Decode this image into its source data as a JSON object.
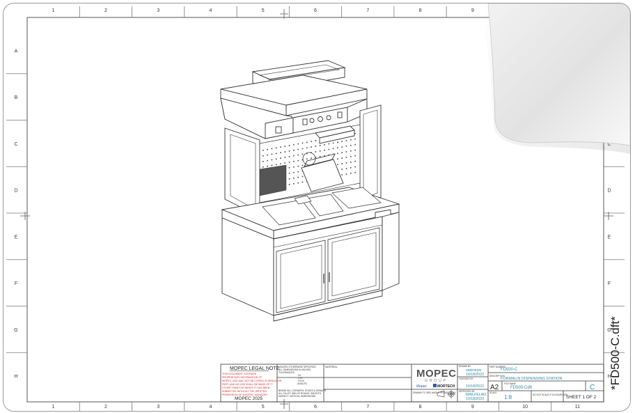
{
  "document": {
    "filename_tab": "*FD500-C.dft*",
    "columns": [
      "1",
      "2",
      "3",
      "4",
      "5",
      "6",
      "7",
      "8",
      "9",
      "10",
      "11"
    ],
    "rows": [
      "A",
      "B",
      "C",
      "D",
      "E",
      "F",
      "G",
      "H"
    ]
  },
  "revision_table": {
    "headers": [
      "REV",
      "DESCRIPTION",
      "DATE",
      "CHK'D",
      "MARK"
    ],
    "row": [
      "A",
      "INITIAL RELEASE",
      "00-000-00",
      "XXXXX",
      "MM"
    ]
  },
  "legal_note": {
    "title": "MOPEC LEGAL NOTE",
    "lines": [
      "THIS DOCUMENT CONTAINS",
      "PROPRIETARY INFORMATION OF",
      "MOPEC, AND MAY NOT BE COPIED IN WHOLE OR",
      "PART, AND NO USE SHALL BE MADE OF IT",
      "OTHER THAN FOR WHICH IT HAS BEEN",
      "SUBMITTED WITHOUT THE WRITTEN",
      "PERMISSION OF A MOPEC MANAGER."
    ],
    "footer": "MOPEC 2025"
  },
  "tolerances": {
    "lines": [
      "UNLESS OTHERWISE SPECIFIED",
      "ALL DIMENSIONS IN INCHES",
      "TOLERANCES:"
    ],
    "values": [
      ".XX",
      ".XXX",
      ".XXXX",
      "ANGLES"
    ],
    "notes": [
      "BREAK ALL CORNERS, EDGES & DEBURR",
      "ALL FILLET WELDS ROUND, SMOOTH",
      "INSPECT CRITICAL DIMENSIONS"
    ]
  },
  "material_label": "MATERIAL",
  "logo": {
    "main": "MOPEC",
    "sub": "GROUP",
    "partner_left": "Mopec",
    "partner_right": "MORTECH"
  },
  "drawn_info": {
    "drawn_label": "DRAWN BY",
    "drawn_by": "statmeyer",
    "drawn_date": "10/18/2023",
    "checked_label": "CHECKED BY",
    "checked_date": "10/18/2023",
    "approved_label": "APPROVED BY",
    "approved_by": "MAILFELAN",
    "approved_date": "10/18/2023",
    "projection_label": "DRAWN TO 3RD ANGLE PROJECTION"
  },
  "title_block": {
    "part_label": "PART NUMBER",
    "part_number": "FD500-C",
    "desc_label": "DESCRIPTION",
    "description": "FORMALIN DISPENSING STATION",
    "size": "A2",
    "file_label": "FILE NAME",
    "file_name": "FD500-Cdft",
    "rev": "C",
    "scale_label": "SCALE",
    "scale": "1:8",
    "no_scale": "DO NOT SCALE IF IN DOUBT ASK",
    "sheet": "SHEET 1 OF 2"
  }
}
